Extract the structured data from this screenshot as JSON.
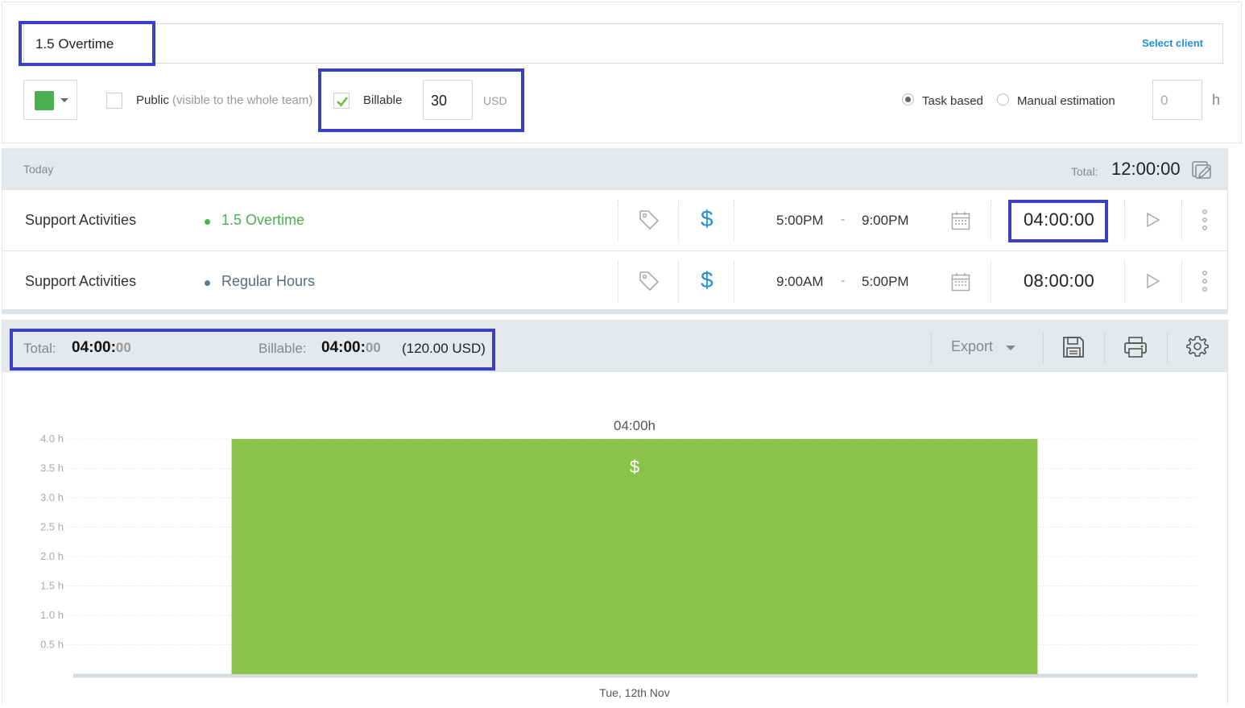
{
  "project": {
    "name": "1.5 Overtime",
    "select_client": "Select client",
    "color": "#4caf50",
    "public_label": "Public",
    "public_hint": "(visible to the whole team)",
    "billable_label": "Billable",
    "billable_checked": true,
    "rate": "30",
    "currency": "USD",
    "estimate_modes": [
      "Task based",
      "Manual estimation"
    ],
    "estimate_selected": "Task based",
    "estimate_value": "0",
    "estimate_unit": "h"
  },
  "today": {
    "label": "Today",
    "total_label": "Total:",
    "total_value": "12:00:00",
    "entries": [
      {
        "task": "Support Activities",
        "project": "1.5 Overtime",
        "project_color": "#4caf50",
        "billable_symbol": "$",
        "start": "5:00PM",
        "separator": "-",
        "end": "9:00PM",
        "duration": "04:00:00"
      },
      {
        "task": "Support Activities",
        "project": "Regular Hours",
        "project_color": "#607d8b",
        "billable_symbol": "$",
        "start": "9:00AM",
        "separator": "-",
        "end": "5:00PM",
        "duration": "08:00:00"
      }
    ]
  },
  "summary": {
    "total_label": "Total:",
    "total_main": "04:00:",
    "total_sec": "00",
    "billable_label": "Billable:",
    "billable_main": "04:00:",
    "billable_sec": "00",
    "billable_amount": "(120.00 USD)",
    "export_label": "Export"
  },
  "chart_data": {
    "type": "bar",
    "categories": [
      "Tue, 12th Nov"
    ],
    "values": [
      4.0
    ],
    "value_labels": [
      "04:00h"
    ],
    "bar_symbol": "$",
    "y_ticks": [
      "0.5 h",
      "1.0 h",
      "1.5 h",
      "2.0 h",
      "2.5 h",
      "3.0 h",
      "3.5 h",
      "4.0 h"
    ],
    "ylim": [
      0,
      4.0
    ],
    "grid": true,
    "bar_color": "#8bc34a"
  }
}
